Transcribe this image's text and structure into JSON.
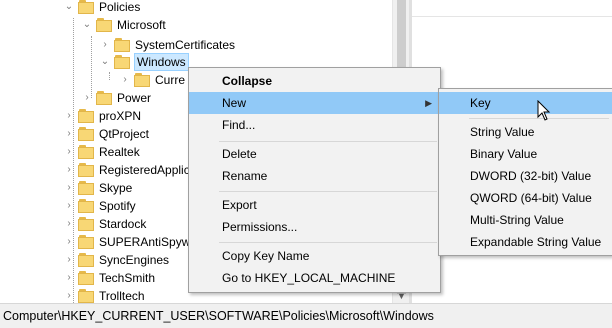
{
  "tree": {
    "items": [
      {
        "label": "Policies",
        "state": "expanded"
      },
      {
        "label": "Microsoft",
        "state": "expanded"
      },
      {
        "label": "SystemCertificates",
        "state": "collapsed"
      },
      {
        "label": "Windows",
        "state": "expanded",
        "selected": true
      },
      {
        "label": "Curre",
        "state": "collapsed"
      },
      {
        "label": "Power",
        "state": "collapsed"
      },
      {
        "label": "proXPN",
        "state": "collapsed"
      },
      {
        "label": "QtProject",
        "state": "collapsed"
      },
      {
        "label": "Realtek",
        "state": "collapsed"
      },
      {
        "label": "RegisteredApplic",
        "state": "collapsed"
      },
      {
        "label": "Skype",
        "state": "collapsed"
      },
      {
        "label": "Spotify",
        "state": "collapsed"
      },
      {
        "label": "Stardock",
        "state": "collapsed"
      },
      {
        "label": "SUPERAntiSpywa",
        "state": "collapsed"
      },
      {
        "label": "SyncEngines",
        "state": "collapsed"
      },
      {
        "label": "TechSmith",
        "state": "collapsed"
      },
      {
        "label": "Trolltech",
        "state": "collapsed"
      }
    ]
  },
  "context_menu": {
    "items": [
      {
        "label": "Collapse"
      },
      {
        "label": "New"
      },
      {
        "label": "Find..."
      },
      {
        "label": "Delete"
      },
      {
        "label": "Rename"
      },
      {
        "label": "Export"
      },
      {
        "label": "Permissions..."
      },
      {
        "label": "Copy Key Name"
      },
      {
        "label": "Go to HKEY_LOCAL_MACHINE"
      }
    ]
  },
  "submenu": {
    "items": [
      {
        "label": "Key"
      },
      {
        "label": "String Value"
      },
      {
        "label": "Binary Value"
      },
      {
        "label": "DWORD (32-bit) Value"
      },
      {
        "label": "QWORD (64-bit) Value"
      },
      {
        "label": "Multi-String Value"
      },
      {
        "label": "Expandable String Value"
      }
    ]
  },
  "status": {
    "path": "Computer\\HKEY_CURRENT_USER\\SOFTWARE\\Policies\\Microsoft\\Windows"
  },
  "colors": {
    "highlight": "#91c9f7",
    "selection": "#cce8ff",
    "folder": "#f8d775"
  },
  "icons": {
    "expanded": "chevron-down-icon",
    "collapsed": "chevron-right-icon",
    "folder": "folder-icon",
    "submenu": "submenu-arrow-icon"
  }
}
